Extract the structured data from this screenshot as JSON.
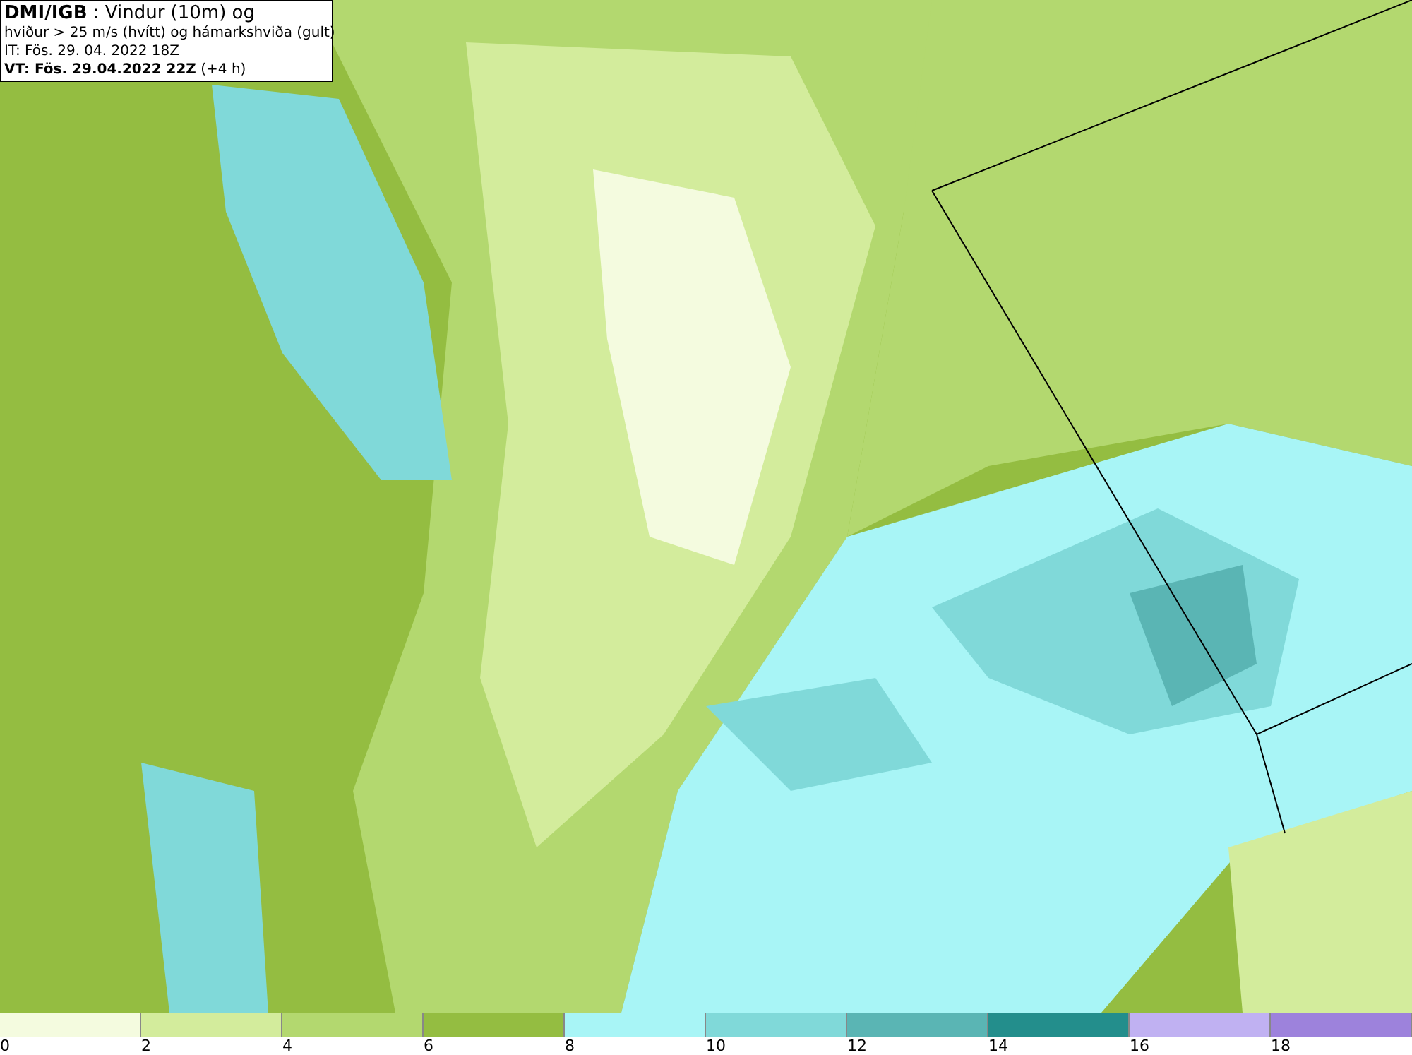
{
  "info_box": {
    "lines": [
      "**DMI/IGB** : Vindur (10m) og",
      "hviður > 25 m/s (hvítt) og hámarkshviða (gult)",
      "IT: Fös. 29. 04. 2022 18Z",
      "**VT: Fös. 29.04.2022 22Z** (+4 h)"
    ]
  },
  "legend": [
    {
      "label": "0",
      "color": "#f4fbdf"
    },
    {
      "label": "2",
      "color": "#d3ec9c"
    },
    {
      "label": "4",
      "color": "#b3d86f"
    },
    {
      "label": "6",
      "color": "#94bd41"
    },
    {
      "label": "8",
      "color": "#a8f5f6"
    },
    {
      "label": "10",
      "color": "#80d9d9"
    },
    {
      "label": "12",
      "color": "#5ab5b4"
    },
    {
      "label": "14",
      "color": "#238e8c"
    },
    {
      "label": "16",
      "color": "#c0b1f2"
    },
    {
      "label": "18",
      "color": "#9d82dc"
    }
  ]
}
